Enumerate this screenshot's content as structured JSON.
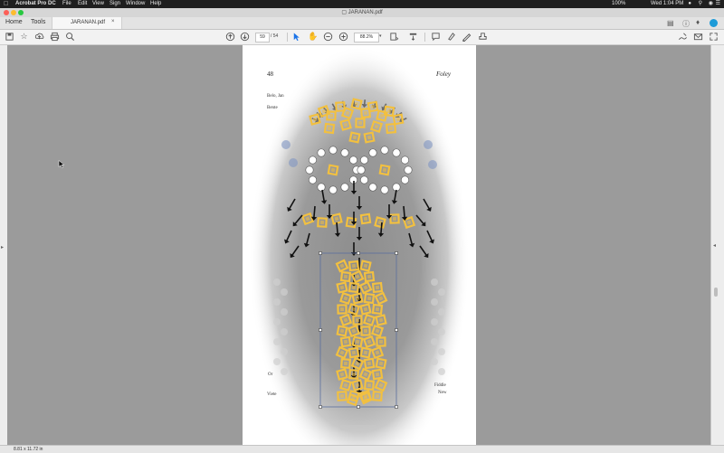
{
  "menubar": {
    "app_name": "Acrobat Pro DC",
    "items": [
      "File",
      "Edit",
      "View",
      "Sign",
      "Window",
      "Help"
    ],
    "battery": "100%",
    "clock": "Wed 1:04 PM"
  },
  "window": {
    "title": "JARANAN.pdf"
  },
  "tabs": {
    "home": "Home",
    "tools": "Tools",
    "file_tab": "JARANAN.pdf",
    "close_glyph": "×"
  },
  "toolbar": {
    "current_page": "59",
    "page_separator": "/ 54",
    "zoom": "88.2%",
    "icons": [
      "save-icon",
      "bookmark-star-icon",
      "upload-icon",
      "print-icon",
      "search-icon",
      "page-up-icon",
      "page-down-icon",
      "select-cursor-icon",
      "hand-icon",
      "zoom-out-icon",
      "zoom-in-icon",
      "page-fit-icon",
      "scroll-icon",
      "comment-icon",
      "highlight-icon",
      "sign-icon",
      "stamp-icon",
      "fill-sign-icon",
      "email-icon",
      "expand-icon"
    ]
  },
  "page": {
    "number": "48",
    "running_head": "Foley",
    "fragments": [
      "Belo, Jan",
      "Bente",
      "Or",
      "Viete",
      "Fiddle",
      "New"
    ]
  },
  "status": {
    "page_size": "8.81 x 11.72 in"
  },
  "colors": {
    "menubar": "#1f1f1f",
    "highlight_box": "#f2c040",
    "arrow": "#111111",
    "selection_frame": "#5a6e9e"
  }
}
